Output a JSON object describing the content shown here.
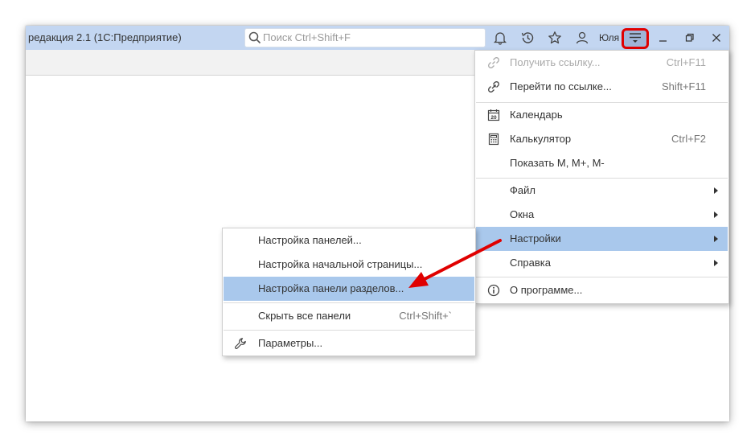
{
  "titlebar": {
    "app_title": "редакция 2.1  (1С:Предприятие)",
    "search_placeholder": "Поиск Ctrl+Shift+F",
    "user_name": "Юля",
    "icons": [
      "bell-icon",
      "history-icon",
      "star-icon",
      "user-icon",
      "hamburger-menu-icon",
      "minimize-icon",
      "restore-icon",
      "close-icon"
    ]
  },
  "main_menu": {
    "items": [
      {
        "label": "Получить ссылку...",
        "shortcut": "Ctrl+F11",
        "icon": "link-icon",
        "disabled": true
      },
      {
        "label": "Перейти по ссылке...",
        "shortcut": "Shift+F11",
        "icon": "go-to-link-icon"
      },
      {
        "label": "Календарь",
        "shortcut": "",
        "icon": "calendar-icon",
        "icon_text": "20"
      },
      {
        "label": "Калькулятор",
        "shortcut": "Ctrl+F2",
        "icon": "calculator-icon"
      },
      {
        "label": "Показать М, М+, М-",
        "shortcut": ""
      },
      {
        "label": "Файл",
        "submenu": true
      },
      {
        "label": "Окна",
        "submenu": true
      },
      {
        "label": "Настройки",
        "submenu": true,
        "highlighted": true
      },
      {
        "label": "Справка",
        "submenu": true
      },
      {
        "label": "О программе...",
        "icon": "info-icon"
      }
    ]
  },
  "sub_menu": {
    "items": [
      {
        "label": "Настройка панелей..."
      },
      {
        "label": "Настройка начальной страницы..."
      },
      {
        "label": "Настройка панели разделов...",
        "highlighted": true
      },
      {
        "label": "Скрыть все панели",
        "shortcut": "Ctrl+Shift+`"
      },
      {
        "label": "Параметры...",
        "icon": "wrench-icon"
      }
    ]
  },
  "colors": {
    "titlebar_bg": "#c3d6f1",
    "highlight_bg": "#a9c8ec",
    "annotation_red": "#e00000"
  }
}
